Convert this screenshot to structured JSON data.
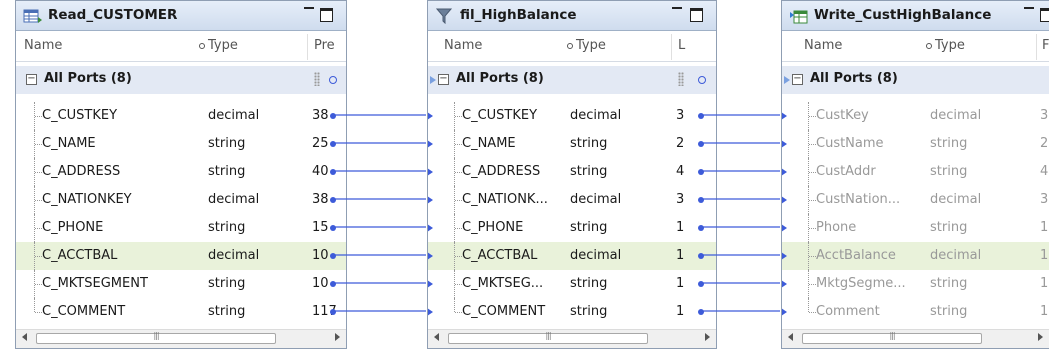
{
  "panels": [
    {
      "title": "Read_CUSTOMER",
      "icon": "source-table-icon",
      "columns": [
        "Name",
        "Type",
        "Pre"
      ],
      "group_label": "All Ports (8)",
      "rows": [
        {
          "name": "C_CUSTKEY",
          "type": "decimal",
          "extra": "38"
        },
        {
          "name": "C_NAME",
          "type": "string",
          "extra": "25"
        },
        {
          "name": "C_ADDRESS",
          "type": "string",
          "extra": "40"
        },
        {
          "name": "C_NATIONKEY",
          "type": "decimal",
          "extra": "38"
        },
        {
          "name": "C_PHONE",
          "type": "string",
          "extra": "15"
        },
        {
          "name": "C_ACCTBAL",
          "type": "decimal",
          "extra": "10"
        },
        {
          "name": "C_MKTSEGMENT",
          "type": "string",
          "extra": "10"
        },
        {
          "name": "C_COMMENT",
          "type": "string",
          "extra": "117"
        }
      ]
    },
    {
      "title": "fil_HighBalance",
      "icon": "filter-icon",
      "columns": [
        "Name",
        "Type",
        "L"
      ],
      "group_label": "All Ports (8)",
      "rows": [
        {
          "name": "C_CUSTKEY",
          "type": "decimal",
          "extra": "3"
        },
        {
          "name": "C_NAME",
          "type": "string",
          "extra": "2"
        },
        {
          "name": "C_ADDRESS",
          "type": "string",
          "extra": "4"
        },
        {
          "name": "C_NATIONK...",
          "type": "decimal",
          "extra": "3"
        },
        {
          "name": "C_PHONE",
          "type": "string",
          "extra": "1"
        },
        {
          "name": "C_ACCTBAL",
          "type": "decimal",
          "extra": "1"
        },
        {
          "name": "C_MKTSEG...",
          "type": "string",
          "extra": "1"
        },
        {
          "name": "C_COMMENT",
          "type": "string",
          "extra": "1"
        }
      ]
    },
    {
      "title": "Write_CustHighBalance",
      "icon": "target-table-icon",
      "columns": [
        "Name",
        "Type",
        "F"
      ],
      "group_label": "All Ports (8)",
      "rows": [
        {
          "name": "CustKey",
          "type": "decimal",
          "extra": "3"
        },
        {
          "name": "CustName",
          "type": "string",
          "extra": "2"
        },
        {
          "name": "CustAddr",
          "type": "string",
          "extra": "4"
        },
        {
          "name": "CustNation...",
          "type": "decimal",
          "extra": "3"
        },
        {
          "name": "Phone",
          "type": "string",
          "extra": "1"
        },
        {
          "name": "AcctBalance",
          "type": "decimal",
          "extra": "1"
        },
        {
          "name": "MktgSegme...",
          "type": "string",
          "extra": "1"
        },
        {
          "name": "Comment",
          "type": "string",
          "extra": "1"
        }
      ]
    }
  ],
  "highlighted_row_index": 5,
  "colors": {
    "link": "#3d5bd9",
    "highlight_row": "#e9f2da",
    "header": "#d9e4f3"
  }
}
